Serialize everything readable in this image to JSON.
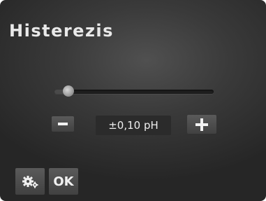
{
  "screen": {
    "title": "Histerezis"
  },
  "hysteresis": {
    "value_label": "±0,10 pH",
    "slider_level": 0.04
  },
  "controls": {
    "decrease_icon": "minus-icon",
    "increase_icon": "plus-icon",
    "settings_icon": "gears-icon",
    "ok_label": "OK"
  }
}
